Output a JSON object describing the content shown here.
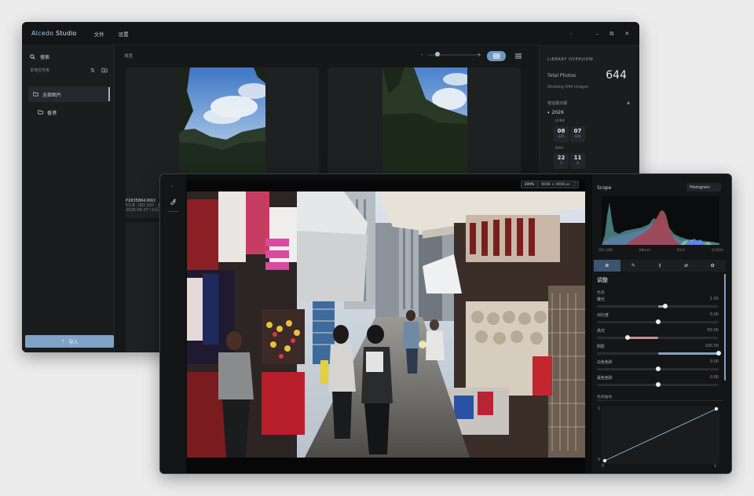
{
  "library_window": {
    "app_title_prefix": "Alcedo",
    "app_title_suffix": " Studio",
    "menu": [
      "文件",
      "设置"
    ],
    "window_controls": {
      "back": "‹",
      "minimize": "–",
      "maximize": "⧉",
      "close": "✕"
    },
    "sidebar": {
      "search_label": "搜索",
      "local_folder_label": "本地文件夹",
      "folders": [
        {
          "label": "全部图片",
          "selected": true
        },
        {
          "label": "香港",
          "selected": false
        }
      ],
      "import_label": "导入"
    },
    "grid": {
      "view_label": "浏览",
      "zoom_minus": "-",
      "zoom_plus": "+",
      "zoom_level": 0.15,
      "card": {
        "filename": "P2635864.RW2",
        "meta": "f/2.8 · ISO 200 · 1/...",
        "date": "2026-06-07 (公历) 香港..."
      }
    },
    "right_panel": {
      "header": "LIBRARY OVERVIEW",
      "total_label": "Total Photos",
      "total_value": "644",
      "showing": "Showing 644 images",
      "by_date_label": "按拍摄日期",
      "year": "2026",
      "months": [
        {
          "name": "JUNE",
          "days": [
            {
              "day": "08",
              "count": "325"
            },
            {
              "day": "07",
              "count": "434"
            }
          ]
        },
        {
          "name": "MAY",
          "days": [
            {
              "day": "22",
              "count": "3"
            },
            {
              "day": "11",
              "count": "4"
            }
          ]
        }
      ]
    }
  },
  "edit_window": {
    "zoom_pct": "100%",
    "dimensions": "6008 × 4008 px",
    "scope_title": "Scope",
    "scope_button": "Histogram",
    "exif": [
      "ISO 200",
      "28mm",
      "f/3.5",
      "1/320s"
    ],
    "adjust_title": "调整",
    "tone_section": "色调",
    "sliders": [
      {
        "label": "曝光",
        "value": "1.50",
        "pos": 0.56,
        "fill": "blue"
      },
      {
        "label": "对比度",
        "value": "0.00",
        "pos": 0.5,
        "fill": "none"
      },
      {
        "label": "高光",
        "value": "-50.00",
        "pos": 0.25,
        "fill": "red"
      },
      {
        "label": "阴影",
        "value": "100.00",
        "pos": 1.0,
        "fill": "blue"
      },
      {
        "label": "白色色阶",
        "value": "0.00",
        "pos": 0.5,
        "fill": "none"
      },
      {
        "label": "黑色色阶",
        "value": "0.00",
        "pos": 0.5,
        "fill": "none"
      }
    ],
    "curve_section": "色调曲线",
    "curve_y_top": "1",
    "curve_y_bottom": "0",
    "curve_x_left": "0",
    "curve_x_right": "1",
    "colors": {
      "accent": "#7fa3c7",
      "active_tab": "#3a5572",
      "negative": "#c58b8f"
    }
  }
}
